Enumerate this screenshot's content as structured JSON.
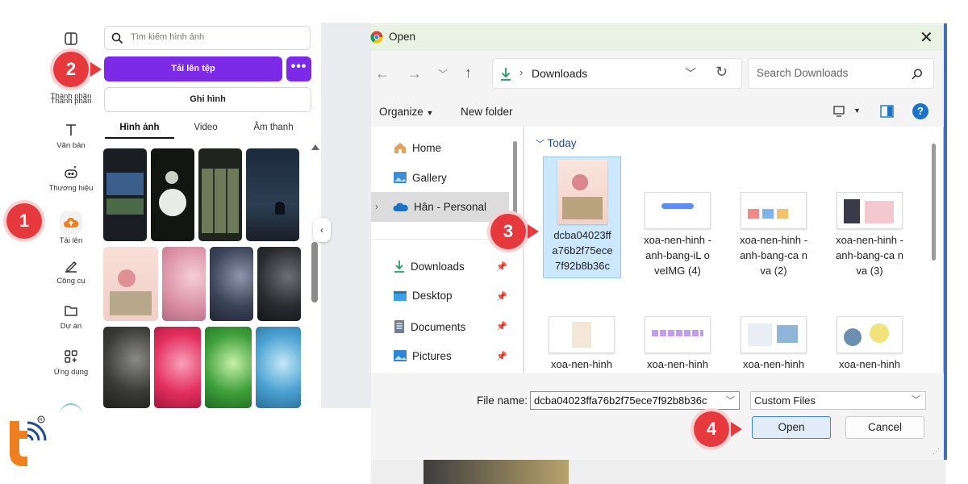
{
  "canva": {
    "rail": [
      {
        "label": "Thành phần",
        "icon": "layout-icon"
      },
      {
        "label": "Văn bản",
        "icon": "text-icon"
      },
      {
        "label": "Thương hiệu",
        "icon": "brand-icon"
      },
      {
        "label": "Tải lên",
        "icon": "cloud-upload-icon"
      },
      {
        "label": "Công cụ",
        "icon": "draw-icon"
      },
      {
        "label": "Dự án",
        "icon": "folder-icon"
      },
      {
        "label": "Ứng dụng",
        "icon": "apps-icon"
      }
    ],
    "search_placeholder": "Tìm kiếm hình ảnh",
    "upload_label": "Tải lên tệp",
    "more_label": "•••",
    "record_label": "Ghi hình",
    "tabs": [
      "Hình ảnh",
      "Video",
      "Âm thanh"
    ]
  },
  "dialog": {
    "title": "Open",
    "address": "Downloads",
    "search_placeholder": "Search Downloads",
    "organize": "Organize",
    "new_folder": "New folder",
    "nav": [
      {
        "label": "Home",
        "icon": "home-icon"
      },
      {
        "label": "Gallery",
        "icon": "gallery-icon"
      },
      {
        "label": "Hân - Personal",
        "icon": "onedrive-icon"
      },
      {
        "label": "Downloads",
        "icon": "download-icon"
      },
      {
        "label": "Desktop",
        "icon": "desktop-icon"
      },
      {
        "label": "Documents",
        "icon": "documents-icon"
      },
      {
        "label": "Pictures",
        "icon": "pictures-icon"
      }
    ],
    "group_label": "Today",
    "files": [
      {
        "name": "dcba04023ff a76b2f75ece 7f92b8b36c"
      },
      {
        "name": "xoa-nen-hinh -anh-bang-iL oveIMG (4)"
      },
      {
        "name": "xoa-nen-hinh -anh-bang-ca nva (2)"
      },
      {
        "name": "xoa-nen-hinh -anh-bang-ca nva (3)"
      },
      {
        "name": "xoa-nen-hinh"
      },
      {
        "name": "xoa-nen-hinh"
      },
      {
        "name": "xoa-nen-hinh"
      },
      {
        "name": "xoa-nen-hinh"
      }
    ],
    "file_name_label": "File name:",
    "file_name_value": "dcba04023ffa76b2f75ece7f92b8b36c",
    "filter": "Custom Files",
    "open_label": "Open",
    "cancel_label": "Cancel"
  },
  "steps": [
    "1",
    "2",
    "3",
    "4"
  ],
  "colors": {
    "canva_purple": "#7d2ae8",
    "badge_red": "#e6393d",
    "selection_blue": "#cce8ff",
    "accent_orange": "#f07f1e"
  }
}
